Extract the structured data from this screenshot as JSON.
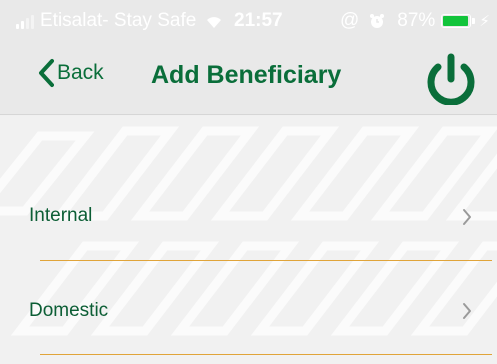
{
  "status_bar": {
    "carrier": "Etisalat- Stay Safe",
    "time": "21:57",
    "battery_percent": "87%",
    "battery_level": 0.87,
    "icons": [
      "signal-icon",
      "wifi-icon",
      "at-icon",
      "alarm-icon",
      "battery-icon",
      "charging-icon"
    ]
  },
  "nav": {
    "back_label": "Back",
    "title": "Add Beneficiary",
    "power_icon": "power-icon"
  },
  "list": {
    "items": [
      {
        "label": "Internal",
        "icon": "chevron-right-icon"
      },
      {
        "label": "Domestic",
        "icon": "chevron-right-icon"
      }
    ]
  },
  "colors": {
    "brand_green": "#0a6e3a",
    "divider": "#e0a43a",
    "header_bg": "#e9e9e9"
  }
}
